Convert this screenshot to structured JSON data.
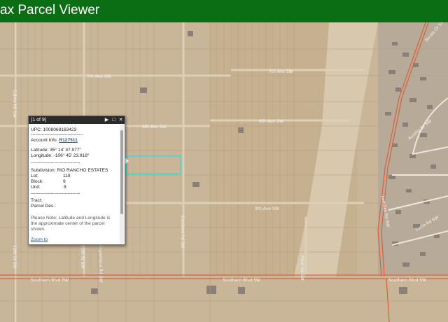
{
  "app": {
    "title": "ax Parcel Viewer"
  },
  "popup": {
    "counter": "(1 of 9)",
    "controls": [
      "next-icon",
      "maximize-icon",
      "close-icon"
    ],
    "upc": "UPC: 1008068163423",
    "account_label": "Account Info:",
    "account_value": "R127511",
    "latitude": "Latitude: 35° 14' 37.977\"",
    "longitude": "Longitude: -106° 45' 23.918\"",
    "separator": "--------------------------------",
    "subdivision": "Subdivision: RIO RANCHO ESTATES",
    "lot_label": "Lot:",
    "lot_value": "118",
    "block_label": "Block:",
    "block_value": "9",
    "unit_label": "Unit:",
    "unit_value": "8",
    "separator2": "--------------------------------",
    "tract": "Tract:",
    "parcel_desc": "Parcel Des.:",
    "note": "Please Note: Latitude and Longitude is the approximate center of the parcel shown.",
    "zoom": "Zoom to"
  },
  "map": {
    "road_labels": [
      "7th Ave SW",
      "7th Ave SW",
      "8th Ave SW",
      "8th Ave SW",
      "9th Ave SW",
      "Southern Blvd SW",
      "Southern Blvd SW",
      "Southern Blvd SW",
      "Aurelia Dr SW",
      "Nicole Dr SW",
      "Lucia Rd SW",
      "Lomitas Rd SW",
      "Colina Rd SW",
      "Pinal Rd SW",
      "12th St SW",
      "11th St SW",
      "Cordova Rd SW",
      "Cuyamaca Rd SW"
    ],
    "colors": {
      "header": "#0b6d14",
      "parcel_highlight": "#38e0d4",
      "major_road": "#d8603a",
      "land": "#c8b598"
    }
  }
}
